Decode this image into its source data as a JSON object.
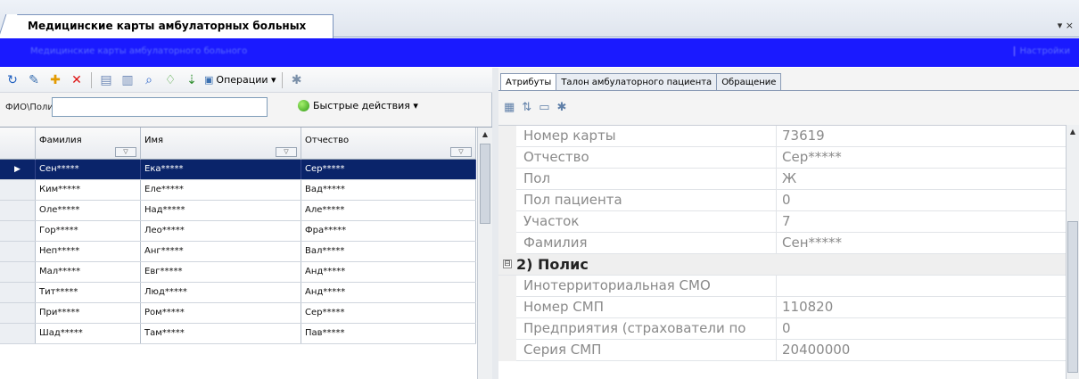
{
  "document_tab": {
    "title": "Медицинские карты амбулаторных больных",
    "controls": "▾ ×"
  },
  "banner": {
    "title": "Медицинские карты амбулаторного больного",
    "right": "Настройки"
  },
  "left_toolbar": {
    "operations_label": "Операции ▾"
  },
  "search": {
    "label": "ФИО\\Полис:",
    "value": "",
    "quick_actions_label": "Быстрые действия ▾"
  },
  "grid": {
    "columns": [
      "Фамилия",
      "Имя",
      "Отчество"
    ],
    "selected_marker": "▶",
    "rows": [
      [
        "Сен*****",
        "Ека*****",
        "Сер*****"
      ],
      [
        "Ким*****",
        "Еле*****",
        "Вад*****"
      ],
      [
        "Оле*****",
        "Над*****",
        "Але*****"
      ],
      [
        "Гор*****",
        "Лео*****",
        "Фра*****"
      ],
      [
        "Неп*****",
        "Анг*****",
        "Вал*****"
      ],
      [
        "Мал*****",
        "Евг*****",
        "Анд*****"
      ],
      [
        "Тит*****",
        "Люд*****",
        "Анд*****"
      ],
      [
        "При*****",
        "Ром*****",
        "Сер*****"
      ],
      [
        "Шад*****",
        "Там*****",
        "Пав*****"
      ]
    ]
  },
  "right_tabs": [
    "Атрибуты",
    "Талон амбулаторного пациента",
    "Обращение"
  ],
  "properties": {
    "rows": [
      {
        "name": "Номер карты",
        "value": "73619"
      },
      {
        "name": "Отчество",
        "value": "Сер*****"
      },
      {
        "name": "Пол",
        "value": "Ж"
      },
      {
        "name": "Пол пациента",
        "value": "0"
      },
      {
        "name": "Участок",
        "value": "7"
      },
      {
        "name": "Фамилия",
        "value": "Сен*****"
      }
    ],
    "category": {
      "toggle": "⊟",
      "label": "2) Полис"
    },
    "rows2": [
      {
        "name": "Инотерриториальная СМО",
        "value": ""
      },
      {
        "name": "Номер СМП",
        "value": "110820"
      },
      {
        "name": "Предприятия (страхователи по",
        "value": "0"
      },
      {
        "name": "Серия СМП",
        "value": "20400000"
      }
    ]
  }
}
